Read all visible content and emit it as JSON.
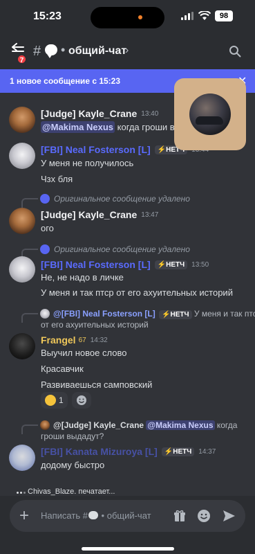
{
  "status_bar": {
    "time": "15:23",
    "battery": "98"
  },
  "header": {
    "back_badge": "7",
    "hash": "#",
    "separator": "•",
    "channel_name": "общий-чат",
    "chevron": "›"
  },
  "new_messages_bar": {
    "text": "1 новое сообщение с 15:23",
    "close": "✕"
  },
  "messages": [
    {
      "author": "[Judge] Kayle_Crane",
      "author_color": "#f2f3f5",
      "time": "13:40",
      "mention": "@Makima Nexus",
      "text": "когда гроши выдадут?"
    },
    {
      "author": "[FBI] Neal Fosterson [L]",
      "author_color": "#5a6bff",
      "tag": "⚡НЕТЧ",
      "time": "13:44",
      "lines": [
        "У меня не получилось",
        "Чзх бля"
      ]
    },
    {
      "deleted_text": "Оригинальное сообщение удалено",
      "author": "[Judge] Kayle_Crane",
      "author_color": "#f2f3f5",
      "time": "13:47",
      "lines": [
        "ого"
      ]
    },
    {
      "deleted_text": "Оригинальное сообщение удалено",
      "author": "[FBI] Neal Fosterson [L]",
      "author_color": "#5a6bff",
      "tag": "⚡НЕТЧ",
      "time": "13:50",
      "lines": [
        "Не, не надо в личке",
        "У меня и так птср от его ахуительных историй"
      ]
    },
    {
      "reply_author": "@[FBI] Neal Fosterson [L]",
      "reply_tag": "⚡НЕТЧ",
      "reply_text_1": "У меня и так птср",
      "reply_text_2": "от его ахуительных историй",
      "author": "Frangel",
      "author_color": "#f0c85a",
      "tag_extra": "67",
      "time": "14:32",
      "lines": [
        "Выучил новое слово",
        "Красавчик",
        "Развиваешься самповский"
      ],
      "reaction_count": "1"
    },
    {
      "reply_author": "@[Judge] Kayle_Crane",
      "reply_mention": "@Makima Nexus",
      "reply_text_1": "когда",
      "reply_text_2": "гроши выдадут?",
      "author": "[FBI] Kanata Mizuroya [L]",
      "author_color": "#5a6bff",
      "tag": "⚡НЕТЧ",
      "time": "14:37",
      "lines": [
        "додому быстро"
      ]
    }
  ],
  "typing": {
    "text": "Chivas_Blaze. печатает..."
  },
  "composer": {
    "placeholder": "Написать #",
    "placeholder_suffix": " • общий-чат",
    "add": "+"
  }
}
